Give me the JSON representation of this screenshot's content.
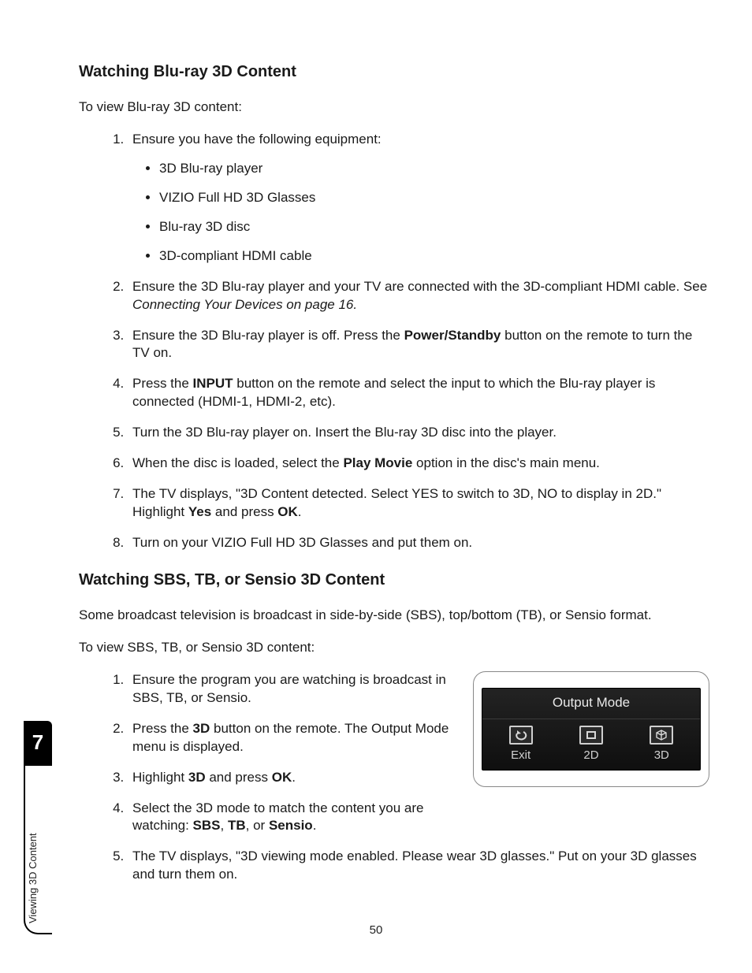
{
  "page_number": "50",
  "sidebar": {
    "chapter_number": "7",
    "chapter_title": "Viewing 3D Content"
  },
  "s1": {
    "heading": "Watching Blu-ray 3D Content",
    "intro": "To view Blu-ray 3D content:",
    "step1": "Ensure you have the following equipment:",
    "eq": {
      "a": "3D Blu-ray player",
      "b": "VIZIO Full HD 3D Glasses",
      "c": "Blu-ray 3D disc",
      "d": "3D-compliant HDMI cable"
    },
    "step2_a": "Ensure the 3D Blu-ray player and your TV are connected with the 3D-compliant HDMI cable. See ",
    "step2_i": "Connecting Your Devices on page 16.",
    "step3_a": "Ensure the 3D Blu-ray player is off. Press the ",
    "step3_b": "Power/Standby",
    "step3_c": " button on the remote to turn the TV on.",
    "step4_a": "Press the ",
    "step4_b": "INPUT",
    "step4_c": " button on the remote and select the input to which the Blu-ray player is connected (HDMI-1, HDMI-2, etc).",
    "step5": "Turn the 3D Blu-ray player on. Insert the Blu-ray 3D disc into the player.",
    "step6_a": "When the disc is loaded, select the ",
    "step6_b": "Play Movie",
    "step6_c": " option in the disc's main menu.",
    "step7_a": "The TV displays, \"3D Content detected. Select YES to switch to 3D, NO to display in 2D.\" Highlight ",
    "step7_b": "Yes",
    "step7_c": " and press ",
    "step7_d": "OK",
    "step7_e": ".",
    "step8": "Turn on your VIZIO Full HD 3D Glasses and put them on."
  },
  "s2": {
    "heading": "Watching SBS, TB, or Sensio 3D Content",
    "p1": "Some broadcast television is broadcast in side-by-side (SBS), top/bottom (TB), or Sensio format.",
    "intro": "To view SBS, TB, or Sensio 3D content:",
    "step1": "Ensure the program you are watching is broadcast in SBS, TB, or Sensio.",
    "step2_a": "Press the ",
    "step2_b": "3D",
    "step2_c": " button on the remote. The Output Mode menu is displayed.",
    "step3_a": "Highlight ",
    "step3_b": "3D",
    "step3_c": " and press ",
    "step3_d": "OK",
    "step3_e": ".",
    "step4_a": "Select the 3D mode to match the content you are watching: ",
    "step4_b": "SBS",
    "step4_c": ", ",
    "step4_d": "TB",
    "step4_e": ", or ",
    "step4_f": "Sensio",
    "step4_g": ".",
    "step5": "The TV displays, \"3D viewing mode enabled. Please wear 3D glasses.\" Put on your 3D glasses and turn them on."
  },
  "osd": {
    "title": "Output Mode",
    "exit": "Exit",
    "opt_2d": "2D",
    "opt_3d": "3D"
  }
}
